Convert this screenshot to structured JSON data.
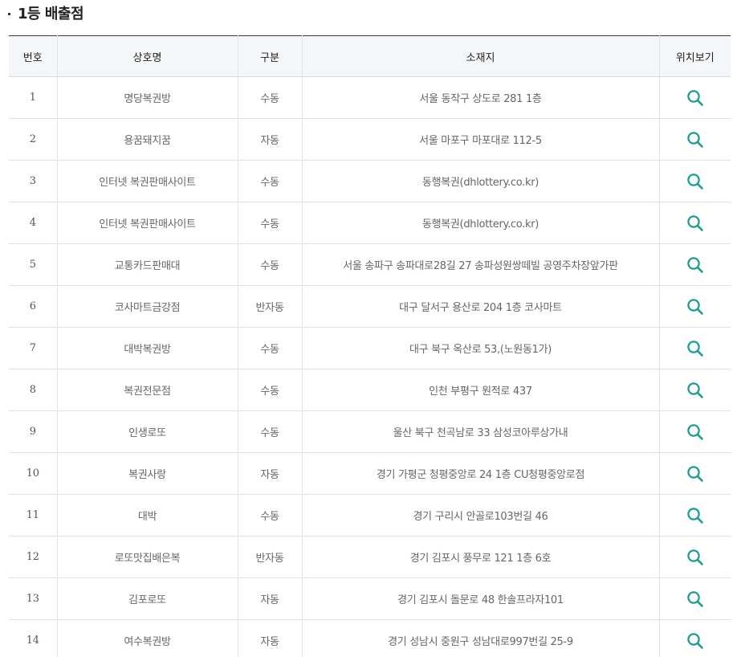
{
  "section": {
    "title": "1등 배출점"
  },
  "table": {
    "headers": {
      "no": "번호",
      "name": "상호명",
      "type": "구분",
      "address": "소재지",
      "map": "위치보기"
    },
    "rows": [
      {
        "no": "1",
        "name": "명당복권방",
        "type": "수동",
        "address": "서울 동작구 상도로 281 1층"
      },
      {
        "no": "2",
        "name": "용꿈돼지꿈",
        "type": "자동",
        "address": "서울 마포구 마포대로 112-5"
      },
      {
        "no": "3",
        "name": "인터넷 복권판매사이트",
        "type": "수동",
        "address": "동행복권(dhlottery.co.kr)"
      },
      {
        "no": "4",
        "name": "인터넷 복권판매사이트",
        "type": "수동",
        "address": "동행복권(dhlottery.co.kr)"
      },
      {
        "no": "5",
        "name": "교통카드판매대",
        "type": "수동",
        "address": "서울 송파구 송파대로28길 27 송파성원쌍떼빌 공영주차장앞가판"
      },
      {
        "no": "6",
        "name": "코사마트금강점",
        "type": "반자동",
        "address": "대구 달서구 용산로 204 1층 코사마트"
      },
      {
        "no": "7",
        "name": "대박복권방",
        "type": "수동",
        "address": "대구 북구 옥산로 53,(노원동1가)"
      },
      {
        "no": "8",
        "name": "복권전문점",
        "type": "수동",
        "address": "인천 부평구 원적로 437"
      },
      {
        "no": "9",
        "name": "인생로또",
        "type": "수동",
        "address": "울산 북구 천곡남로 33 삼성코아루상가내"
      },
      {
        "no": "10",
        "name": "복권사랑",
        "type": "자동",
        "address": "경기 가평군 청평중앙로 24 1층 CU청평중앙로점"
      },
      {
        "no": "11",
        "name": "대박",
        "type": "수동",
        "address": "경기 구리시 안골로103번길 46"
      },
      {
        "no": "12",
        "name": "로또맛집배은복",
        "type": "반자동",
        "address": "경기 김포시 풍무로 121 1층 6호"
      },
      {
        "no": "13",
        "name": "김포로또",
        "type": "자동",
        "address": "경기 김포시 돌문로 48 한솔프라자101"
      },
      {
        "no": "14",
        "name": "여수복권방",
        "type": "자동",
        "address": "경기 성남시 중원구 성남대로997번길 25-9"
      }
    ]
  },
  "colors": {
    "accent": "#1a9e8f",
    "header_bg": "#f5f6f7",
    "top_border": "#3a3a3a"
  },
  "icons": {
    "map_button": "search-icon"
  }
}
